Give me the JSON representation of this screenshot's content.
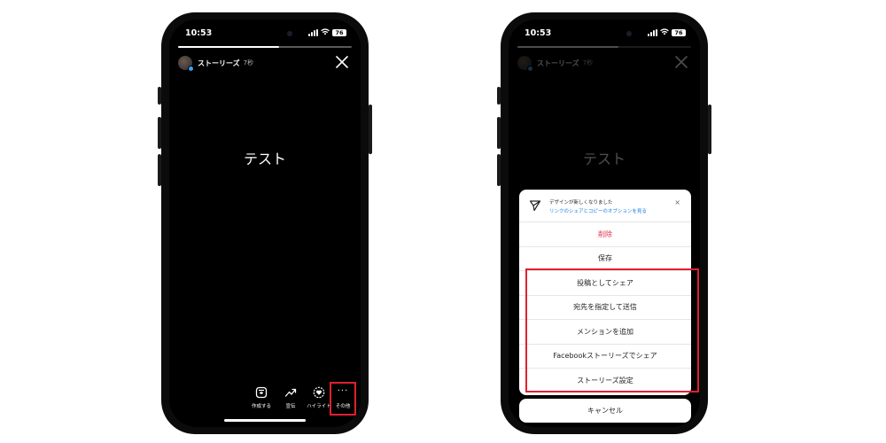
{
  "accent": {
    "highlight_red": "#e02030",
    "delete_red": "#e0304a",
    "link_blue": "#1a7fe0"
  },
  "status_bar": {
    "time": "10:53",
    "battery": "76",
    "icons": [
      "signal-icon",
      "wifi-icon",
      "battery-icon"
    ]
  },
  "story": {
    "username": "ストーリーズ",
    "elapsed": "7秒",
    "content_text": "テスト",
    "progress": 0.58
  },
  "bottom_bar": {
    "create_label": "作成する",
    "boost_label": "宣伝",
    "highlight_label": "ハイライト",
    "more_label": "その他",
    "more_glyph": "···"
  },
  "sheet": {
    "banner_title": "デザインが新しくなりました",
    "banner_link": "リンクのシェアとコピーのオプションを見る",
    "banner_close": "×",
    "items": [
      "削除",
      "保存",
      "投稿としてシェア",
      "宛先を指定して送信",
      "メンションを追加",
      "Facebookストーリーズでシェア",
      "ストーリーズ設定"
    ],
    "cancel_label": "キャンセル"
  }
}
